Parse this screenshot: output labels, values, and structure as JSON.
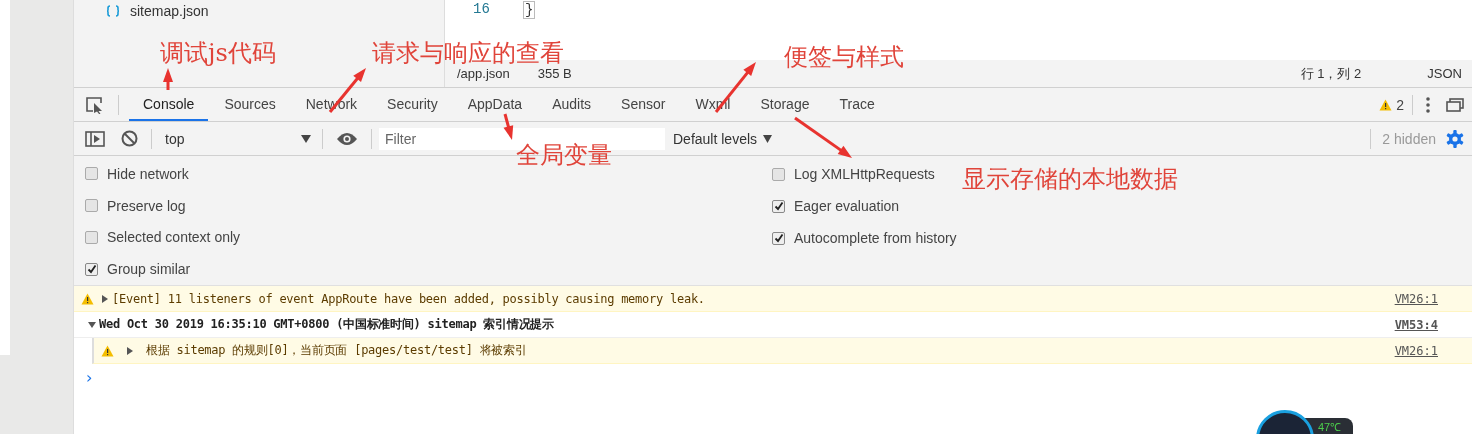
{
  "file_tree": {
    "items": [
      {
        "name": "sitemap.json"
      }
    ]
  },
  "editor": {
    "line_number": "16",
    "code": "}"
  },
  "status_bar": {
    "file": "/app.json",
    "size": "355 B",
    "position": "行 1，列 2",
    "language": "JSON"
  },
  "tabs": [
    {
      "label": "Console",
      "selected": true
    },
    {
      "label": "Sources",
      "selected": false
    },
    {
      "label": "Network",
      "selected": false
    },
    {
      "label": "Security",
      "selected": false
    },
    {
      "label": "AppData",
      "selected": false
    },
    {
      "label": "Audits",
      "selected": false
    },
    {
      "label": "Sensor",
      "selected": false
    },
    {
      "label": "Wxml",
      "selected": false
    },
    {
      "label": "Storage",
      "selected": false
    },
    {
      "label": "Trace",
      "selected": false
    }
  ],
  "warning_count": "2",
  "toolbar": {
    "context": "top",
    "filter_placeholder": "Filter",
    "levels": "Default levels",
    "hidden": "2 hidden"
  },
  "settings_left": [
    {
      "label": "Hide network",
      "checked": false
    },
    {
      "label": "Preserve log",
      "checked": false
    },
    {
      "label": "Selected context only",
      "checked": false
    },
    {
      "label": "Group similar",
      "checked": true
    }
  ],
  "settings_right": [
    {
      "label": "Log XMLHttpRequests",
      "checked": false
    },
    {
      "label": "Eager evaluation",
      "checked": true
    },
    {
      "label": "Autocomplete from history",
      "checked": true
    }
  ],
  "messages": [
    {
      "kind": "warning",
      "expanded": false,
      "text": "[Event] 11 listeners of event AppRoute have been added, possibly causing memory leak.",
      "source": "VM26:1"
    },
    {
      "kind": "group",
      "expanded": true,
      "text": "Wed Oct 30 2019 16:35:10 GMT+0800 (中国标准时间) sitemap 索引情况提示",
      "source": "VM53:4"
    },
    {
      "kind": "nested_warning",
      "expanded": false,
      "text": "根据 sitemap 的规则[0]，当前页面 [pages/test/test] 将被索引",
      "source": "VM26:1"
    }
  ],
  "prompt": "›",
  "annotations": [
    {
      "text": "调试js代码"
    },
    {
      "text": "请求与响应的查看"
    },
    {
      "text": "便签与样式"
    },
    {
      "text": "全局变量"
    },
    {
      "text": "显示存储的本地数据"
    }
  ],
  "temperature": "47℃"
}
